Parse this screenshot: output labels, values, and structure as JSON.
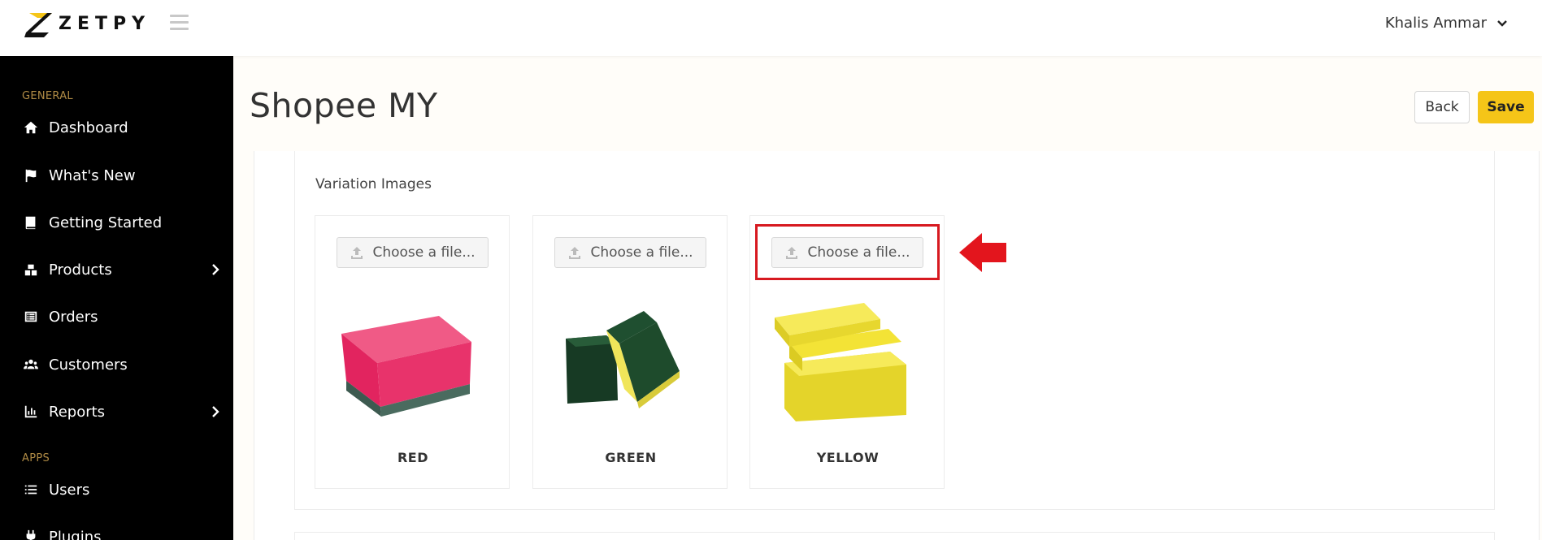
{
  "brand": {
    "name": "ZETPY"
  },
  "user": {
    "name": "Khalis Ammar"
  },
  "sidebar": {
    "section_general": "GENERAL",
    "section_apps": "APPS",
    "items": [
      {
        "label": "Dashboard",
        "icon": "home-icon"
      },
      {
        "label": "What's New",
        "icon": "flag-icon"
      },
      {
        "label": "Getting Started",
        "icon": "book-icon"
      },
      {
        "label": "Products",
        "icon": "boxes-icon"
      },
      {
        "label": "Orders",
        "icon": "list-alt-icon"
      },
      {
        "label": "Customers",
        "icon": "users-icon"
      },
      {
        "label": "Reports",
        "icon": "chart-icon"
      },
      {
        "label": "Users",
        "icon": "list-icon"
      },
      {
        "label": "Plugins",
        "icon": "plug-icon"
      }
    ]
  },
  "page": {
    "title": "Shopee MY",
    "back_label": "Back",
    "save_label": "Save"
  },
  "variations": {
    "section_title": "Variation Images",
    "file_button_label": "Choose a file...",
    "items": [
      {
        "name": "RED",
        "color": "#e8336b"
      },
      {
        "name": "GREEN",
        "color": "#1e4b2c"
      },
      {
        "name": "YELLOW",
        "color": "#f3e336"
      }
    ]
  },
  "colors": {
    "accent": "#f5c518",
    "sidebar_bg": "#000000",
    "section_label": "#b08b45",
    "highlight": "#d71920"
  }
}
